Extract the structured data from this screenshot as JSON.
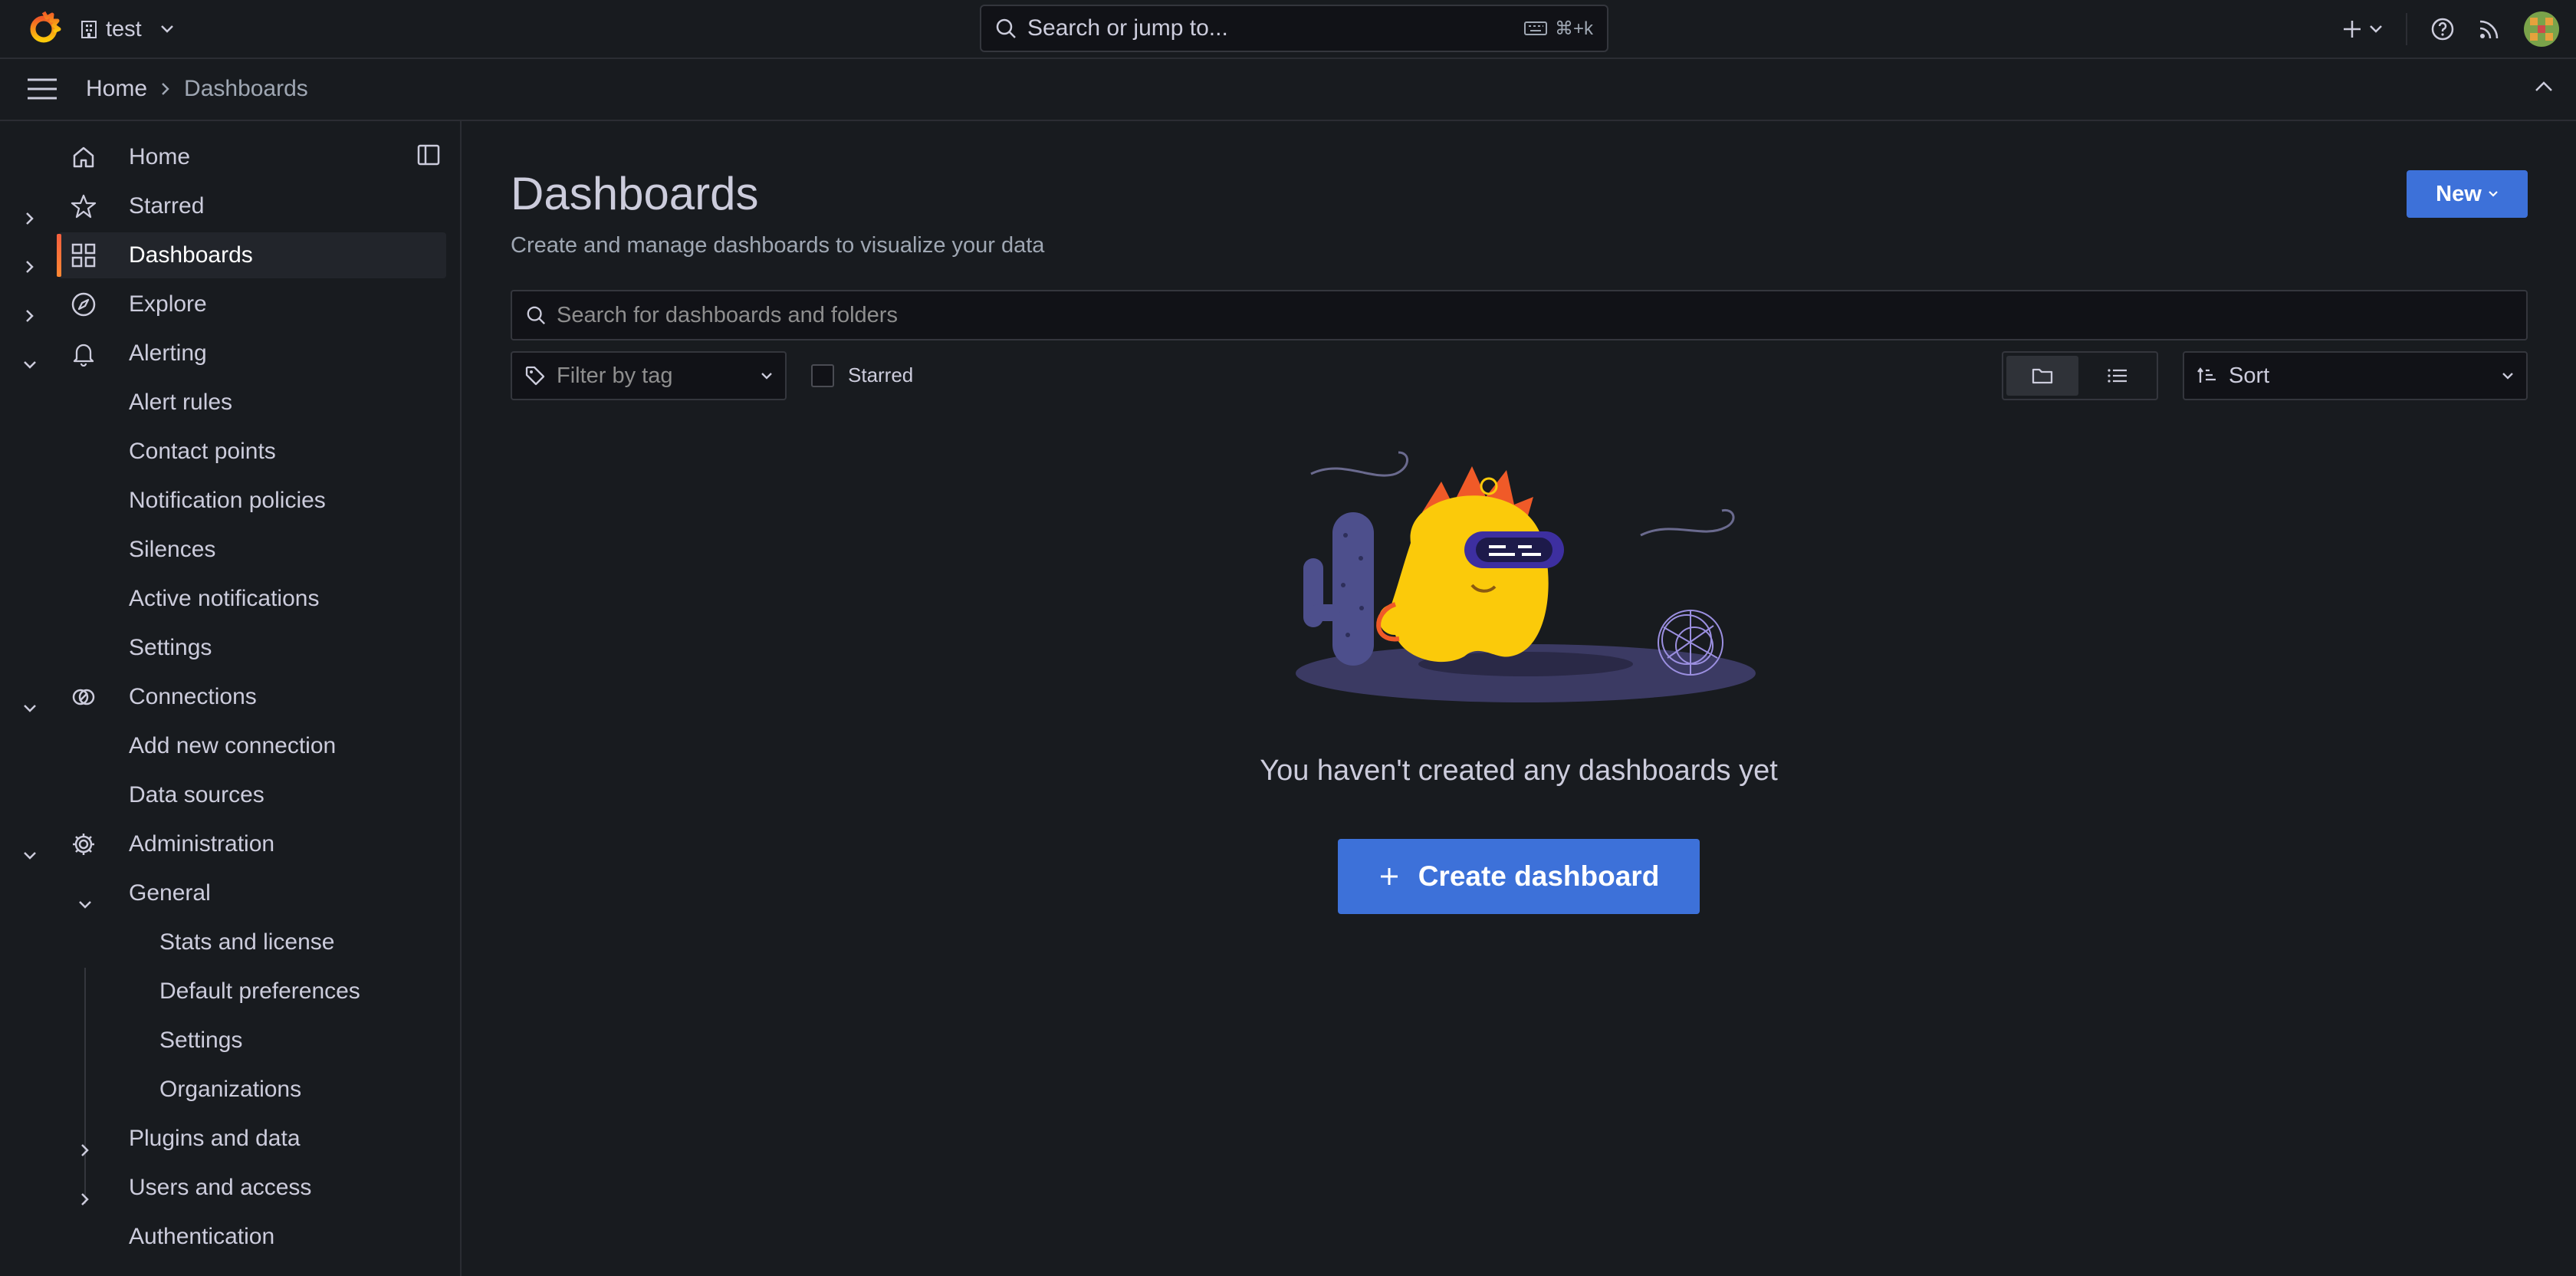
{
  "topbar": {
    "org_name": "test",
    "search_placeholder": "Search or jump to...",
    "search_shortcut": "⌘+k"
  },
  "breadcrumb": {
    "home": "Home",
    "current": "Dashboards"
  },
  "sidebar": {
    "items": {
      "home": "Home",
      "starred": "Starred",
      "dashboards": "Dashboards",
      "explore": "Explore",
      "alerting": "Alerting",
      "alert_rules": "Alert rules",
      "contact_points": "Contact points",
      "notification_policies": "Notification policies",
      "silences": "Silences",
      "active_notifications": "Active notifications",
      "alerting_settings": "Settings",
      "connections": "Connections",
      "add_new_connection": "Add new connection",
      "data_sources": "Data sources",
      "administration": "Administration",
      "general": "General",
      "stats_and_license": "Stats and license",
      "default_preferences": "Default preferences",
      "general_settings": "Settings",
      "organizations": "Organizations",
      "plugins_and_data": "Plugins and data",
      "users_and_access": "Users and access",
      "authentication": "Authentication"
    }
  },
  "main": {
    "title": "Dashboards",
    "subtitle": "Create and manage dashboards to visualize your data",
    "new_button": "New",
    "search_placeholder": "Search for dashboards and folders",
    "filter_tag_placeholder": "Filter by tag",
    "starred_label": "Starred",
    "sort_label": "Sort",
    "empty_message": "You haven't created any dashboards yet",
    "create_button": "Create dashboard"
  },
  "colors": {
    "background": "#181b1f",
    "primary_button": "#3d71d9",
    "active_indicator": "#f55f3e",
    "text": "#ccccdc"
  }
}
